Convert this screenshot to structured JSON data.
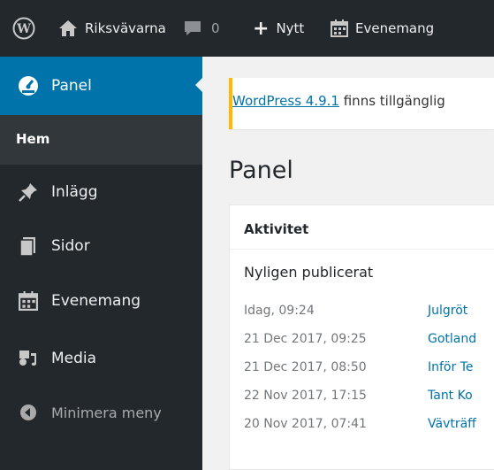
{
  "admin_bar": {
    "logo": "wordpress-logo",
    "site_name": "Riksvävarna",
    "comments_count": "0",
    "new_label": "Nytt",
    "events_label": "Evenemang"
  },
  "sidebar": {
    "items": [
      {
        "label": "Panel",
        "icon": "dashboard-icon"
      },
      {
        "label": "Inlägg",
        "icon": "pin-icon"
      },
      {
        "label": "Sidor",
        "icon": "pages-icon"
      },
      {
        "label": "Evenemang",
        "icon": "calendar-icon"
      },
      {
        "label": "Media",
        "icon": "media-icon"
      }
    ],
    "submenu_current": "Hem",
    "collapse_label": "Minimera meny"
  },
  "notice": {
    "link_text": "WordPress 4.9.1",
    "text_after": " finns tillgänglig"
  },
  "page_title": "Panel",
  "activity": {
    "title": "Aktivitet",
    "section_title": "Nyligen publicerat",
    "posts": [
      {
        "date": "Idag, 09:24",
        "title": "Julgröt"
      },
      {
        "date": "21 Dec 2017, 09:25",
        "title": "Gotland"
      },
      {
        "date": "21 Dec 2017, 08:50",
        "title": "Inför Te"
      },
      {
        "date": "22 Nov 2017, 17:15",
        "title": "Tant Ko"
      },
      {
        "date": "20 Nov 2017, 07:41",
        "title": "Vävträff"
      }
    ]
  },
  "colors": {
    "admin_bg": "#23282d",
    "accent": "#0073aa",
    "notice_border": "#ffb900"
  }
}
